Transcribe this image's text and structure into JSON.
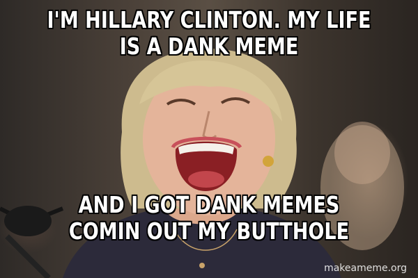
{
  "meme": {
    "top_text": "I'M HILLARY CLINTON. MY LIFE IS A DANK MEME",
    "bottom_text": "AND I GOT DANK MEMES COMIN OUT MY BUTTHOLE",
    "watermark": "makeameme.org"
  },
  "colors": {
    "caption_text": "#ffffff",
    "caption_outline": "#000000",
    "jacket": "#2c2a3a",
    "hair": "#cdbb8e",
    "skin": "#e4b49a"
  }
}
